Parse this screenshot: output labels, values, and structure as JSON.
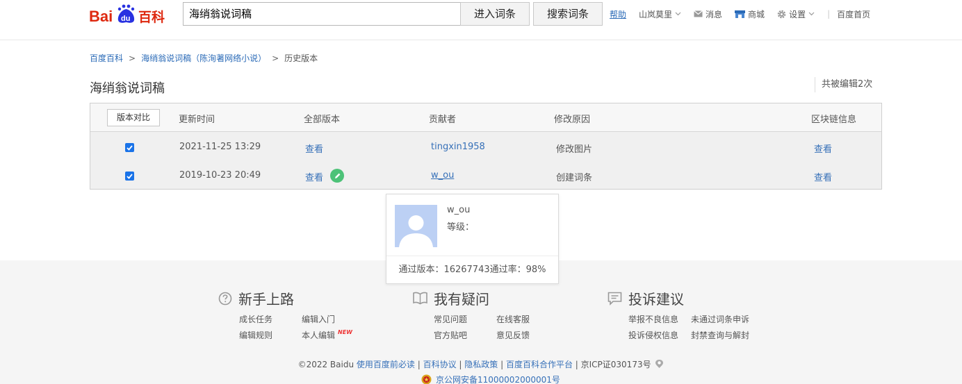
{
  "header": {
    "logo": {
      "brand": "Bai",
      "paw": "du",
      "suffix": "百科"
    },
    "search_value": "海绡翁说词稿",
    "enter_button": "进入词条",
    "search_button": "搜索词条",
    "nav": {
      "help": "帮助",
      "user": "山岚莫里",
      "messages": "消息",
      "mall": "商城",
      "settings": "设置",
      "home": "百度首页"
    }
  },
  "breadcrumb": {
    "home": "百度百科",
    "entry": "海绡翁说词稿（陈洵著网络小说）",
    "current": "历史版本",
    "arrow": ">"
  },
  "title": "海绡翁说词稿",
  "edit_count": "共被编辑2次",
  "table": {
    "compare_button": "版本对比",
    "headers": {
      "time": "更新时间",
      "version": "全部版本",
      "contributor": "贡献者",
      "reason": "修改原因",
      "blockchain": "区块链信息"
    },
    "rows": [
      {
        "time": "2021-11-25 13:29",
        "view": "查看",
        "contributor": "tingxin1958",
        "reason": "修改图片",
        "chain": "查看"
      },
      {
        "time": "2019-10-23 20:49",
        "view": "查看",
        "contributor": "w_ou",
        "reason": "创建词条",
        "chain": "查看"
      }
    ]
  },
  "popup": {
    "name": "w_ou",
    "level_label": "等级：",
    "stats": "通过版本：16267743通过率：98%"
  },
  "footer": {
    "columns": [
      {
        "title": "新手上路",
        "icon": "question-circle-icon",
        "links": [
          "成长任务",
          "编辑入门",
          "编辑规则",
          "本人编辑"
        ]
      },
      {
        "title": "我有疑问",
        "icon": "book-icon",
        "links": [
          "常见问题",
          "在线客服",
          "官方贴吧",
          "意见反馈"
        ]
      },
      {
        "title": "投诉建议",
        "icon": "message-icon",
        "links": [
          "举报不良信息",
          "未通过词条申诉",
          "投诉侵权信息",
          "封禁查询与解封"
        ]
      }
    ],
    "new_tag": "NEW",
    "copyright": {
      "prefix": "©2022 Baidu ",
      "link1": "使用百度前必读",
      "link2": "百科协议",
      "link3": "隐私政策",
      "link4": "百度百科合作平台",
      "icp": "京ICP证030173号",
      "sep": " | "
    },
    "police": "京公网安备11000002000001号"
  },
  "colors": {
    "link": "#3670b8",
    "checkbox": "#1a73e8",
    "edit_badge": "#4dc278",
    "brand_red": "#de2910",
    "brand_blue": "#2932e1"
  }
}
